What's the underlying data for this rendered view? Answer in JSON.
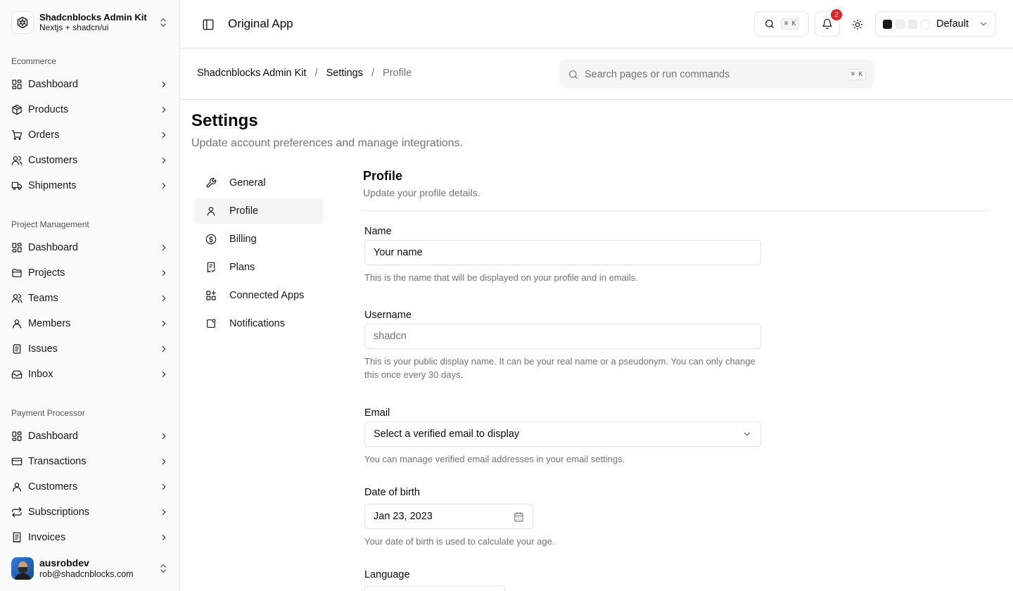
{
  "team": {
    "name": "Shadcnblocks Admin Kit",
    "subtitle": "Nextjs + shadcn/ui"
  },
  "sidebar": {
    "groups": [
      {
        "label": "Ecommerce",
        "items": [
          {
            "label": "Dashboard",
            "icon": "layout-dashboard-icon"
          },
          {
            "label": "Products",
            "icon": "package-icon"
          },
          {
            "label": "Orders",
            "icon": "shopping-cart-icon"
          },
          {
            "label": "Customers",
            "icon": "users-icon"
          },
          {
            "label": "Shipments",
            "icon": "truck-icon"
          }
        ]
      },
      {
        "label": "Project Management",
        "items": [
          {
            "label": "Dashboard",
            "icon": "layout-dashboard-icon"
          },
          {
            "label": "Projects",
            "icon": "folder-icon"
          },
          {
            "label": "Teams",
            "icon": "users-icon"
          },
          {
            "label": "Members",
            "icon": "user-icon"
          },
          {
            "label": "Issues",
            "icon": "clipboard-list-icon"
          },
          {
            "label": "Inbox",
            "icon": "inbox-icon"
          }
        ]
      },
      {
        "label": "Payment Processor",
        "items": [
          {
            "label": "Dashboard",
            "icon": "layout-dashboard-icon"
          },
          {
            "label": "Transactions",
            "icon": "credit-card-icon"
          },
          {
            "label": "Customers",
            "icon": "user-icon"
          },
          {
            "label": "Subscriptions",
            "icon": "repeat-icon"
          },
          {
            "label": "Invoices",
            "icon": "receipt-icon"
          }
        ]
      }
    ]
  },
  "user": {
    "name": "ausrobdev",
    "email": "rob@shadcnblocks.com"
  },
  "header": {
    "app_title": "Original App",
    "search_kbd": "⌘ K",
    "notification_count": "2",
    "preset_label": "Default",
    "swatches": [
      "#171717",
      "#f0f0f0",
      "#ececec",
      "#ffffff"
    ]
  },
  "breadcrumb": {
    "items": [
      "Shadcnblocks Admin Kit",
      "Settings"
    ],
    "current": "Profile",
    "separator": "/"
  },
  "command_search": {
    "placeholder": "Search pages or run commands",
    "kbd": "⌘ K"
  },
  "page": {
    "title": "Settings",
    "description": "Update account preferences and manage integrations."
  },
  "settings_nav": [
    {
      "label": "General",
      "icon": "wrench-icon",
      "active": false
    },
    {
      "label": "Profile",
      "icon": "user-icon",
      "active": true
    },
    {
      "label": "Billing",
      "icon": "dollar-circle-icon",
      "active": false
    },
    {
      "label": "Plans",
      "icon": "receipt-check-icon",
      "active": false
    },
    {
      "label": "Connected Apps",
      "icon": "apps-grid-icon",
      "active": false
    },
    {
      "label": "Notifications",
      "icon": "bell-square-icon",
      "active": false
    }
  ],
  "profile": {
    "title": "Profile",
    "description": "Update your profile details.",
    "name": {
      "label": "Name",
      "placeholder": "Your name",
      "help": "This is the name that will be displayed on your profile and in emails."
    },
    "username": {
      "label": "Username",
      "placeholder": "shadcn",
      "help": "This is your public display name. It can be your real name or a pseudonym. You can only change this once every 30 days."
    },
    "email": {
      "label": "Email",
      "value": "Select a verified email to display",
      "help": "You can manage verified email addresses in your email settings."
    },
    "dob": {
      "label": "Date of birth",
      "value": "Jan 23, 2023",
      "help": "Your date of birth is used to calculate your age."
    },
    "language": {
      "label": "Language"
    }
  }
}
